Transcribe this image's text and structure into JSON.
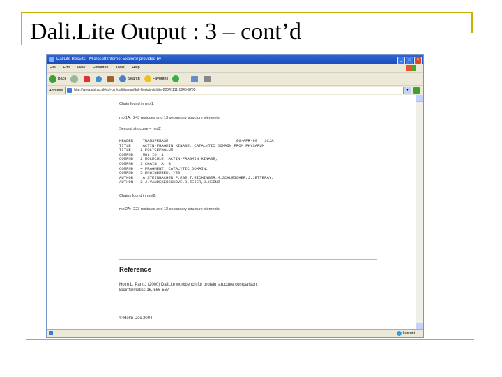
{
  "slide": {
    "title": "Dali.Lite Output : 3 – cont’d",
    "accent_color": "#c8b400"
  },
  "browser": {
    "window_title": "DaliLite Results - Microsoft Internet Explorer provided by",
    "menu": [
      "File",
      "Edit",
      "View",
      "Favorites",
      "Tools",
      "Help"
    ],
    "toolbar": {
      "back": "Back",
      "search": "Search",
      "favorites": "Favorites"
    },
    "address": {
      "label": "Address",
      "url": "http://www.ebi.ac.uk/cgi-bin/dalilite/run/dali-lite/job-dalilite-20041111-1646-9700",
      "go": "Go"
    },
    "status": {
      "zone": "Internet"
    }
  },
  "page": {
    "chain_found_1": "Chain found in mol1:",
    "residues_line_1": "mol1A:  243 residues and 13 secondary structure elements",
    "second_structure": "Second structure = mol2",
    "pdb_header": [
      "HEADER    TRANSFERASE                             06-APR-99   1CJA",
      "TITLE     ACTIN-FRAGMIN KINASE, CATALYTIC DOMAIN FROM PHYSARUM",
      "TITLE    2 POLYCEPHALUM",
      "COMPND    MOL_ID: 1;",
      "COMPND   2 MOLECULE: ACTIN-FRAGMIN KINASE;",
      "COMPND   3 CHAIN: A, B;",
      "COMPND   4 FRAGMENT: CATALYTIC DOMAIN;",
      "COMPND   5 ENGINEERED: YES",
      "AUTHOR    A.STEINBACHER,F.EGE,T.EICHINGER,M.SCHLEICHER,J.JETTERAY,",
      "AUTHOR   2 J.VANDEKERCKHOVE,D.ZEIER,J.HEINZ"
    ],
    "chain_found_2": "Chains found in mol2:",
    "residues_line_2": "mol2A:  223 residues and 12 secondary structure elements",
    "reference_heading": "Reference",
    "reference_lines": [
      "Holm L, Park J (2000) DaliLite workbench for protein structure comparison.",
      "Bioinformatics 16, 566-567"
    ],
    "footer": "© Holm Dec 2004"
  }
}
